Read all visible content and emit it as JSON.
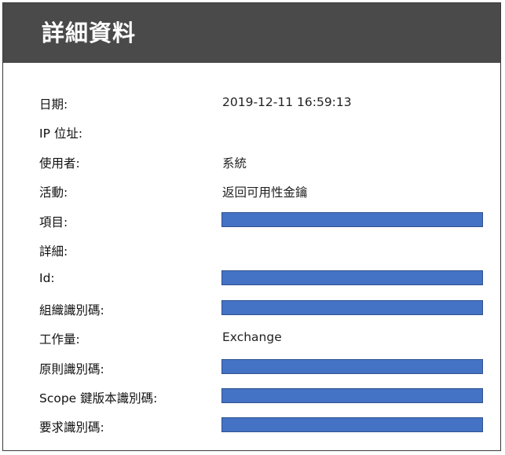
{
  "header": {
    "title": "詳細資料"
  },
  "colors": {
    "header_bg": "#4a4a4a",
    "redaction": "#4472c4"
  },
  "fields": [
    {
      "label": "日期:",
      "value": "2019-12-11 16:59:13",
      "redacted": false
    },
    {
      "label": "IP 位址:",
      "value": "",
      "redacted": false
    },
    {
      "label": "使用者:",
      "value": "系統",
      "redacted": false
    },
    {
      "label": "活動:",
      "value": "返回可用性金鑰",
      "redacted": false
    },
    {
      "label": "項目:",
      "value": "",
      "redacted": true
    },
    {
      "label": "詳細:",
      "value": "",
      "redacted": false
    },
    {
      "label": "Id:",
      "value": "",
      "redacted": true
    },
    {
      "label": "組織識別碼:",
      "value": "",
      "redacted": true
    },
    {
      "label": "工作量:",
      "value": "Exchange",
      "redacted": false
    },
    {
      "label": "原則識別碼:",
      "value": "",
      "redacted": true
    },
    {
      "label": "Scope 鍵版本識別碼:",
      "value": "",
      "redacted": true
    },
    {
      "label": "要求識別碼:",
      "value": "",
      "redacted": true
    }
  ]
}
